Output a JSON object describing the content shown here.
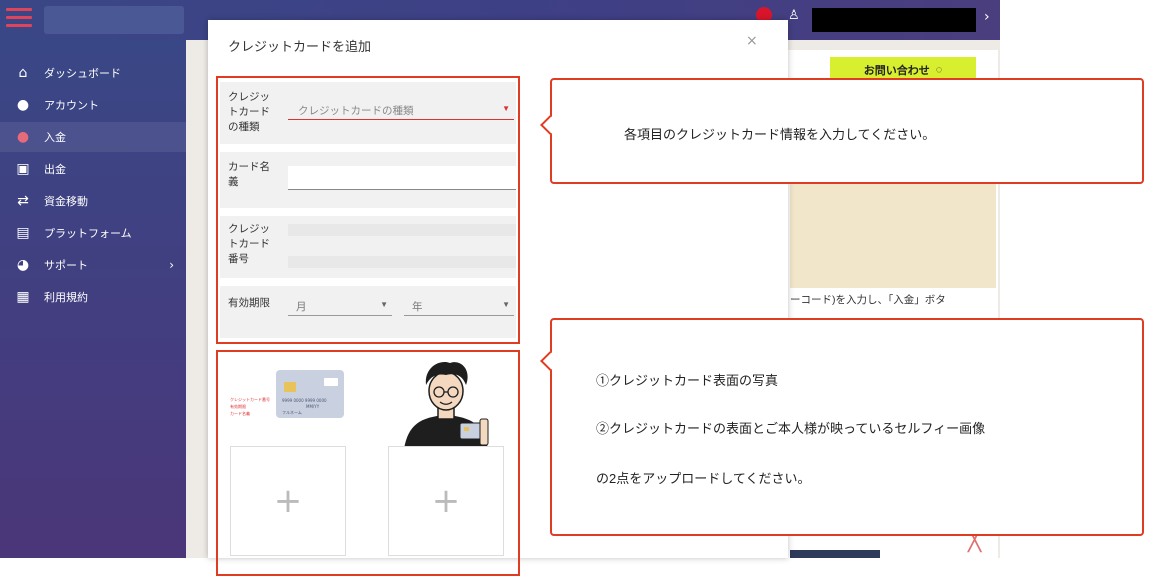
{
  "topbar": {
    "user_icon": "user-icon",
    "user_name": "",
    "arrow": "›"
  },
  "sidebar": {
    "items": [
      {
        "label": "ダッシュボード",
        "icon": "home-icon",
        "glyph": "⌂"
      },
      {
        "label": "アカウント",
        "icon": "account-icon",
        "glyph": "●"
      },
      {
        "label": "入金",
        "icon": "deposit-icon",
        "glyph": "●"
      },
      {
        "label": "出金",
        "icon": "withdraw-icon",
        "glyph": "▣"
      },
      {
        "label": "資金移動",
        "icon": "transfer-icon",
        "glyph": "⇄"
      },
      {
        "label": "プラットフォーム",
        "icon": "platform-icon",
        "glyph": "▤"
      },
      {
        "label": "サポート",
        "icon": "support-icon",
        "glyph": "◕",
        "chevron": "›"
      },
      {
        "label": "利用規約",
        "icon": "terms-icon",
        "glyph": "▦"
      }
    ]
  },
  "background": {
    "contact_button": "お問い合わせ",
    "contact_icon_glyph": "◌",
    "note": "ーコード)を入力し、「入金」ボタ",
    "close_glyph": "╳"
  },
  "modal": {
    "title": "クレジットカードを追加",
    "close_glyph": "×",
    "fields": {
      "card_type_label": "クレジッ\nトカード\nの種類",
      "card_type_placeholder": "クレジットカードの種類",
      "card_name_label": "カード名\n義",
      "card_name_value": "",
      "card_number_label": "クレジッ\nトカード\n番号",
      "expiry_label": "有効期限",
      "month_placeholder": "月",
      "year_placeholder": "年",
      "caret": "▼"
    },
    "card_illustration": {
      "number": "9999 0000 9999 0000",
      "name": "フルネーム",
      "valid": "MM/YY",
      "label_number": "クレジットカード番号",
      "label_valid": "有効期限",
      "label_name": "カード名義"
    },
    "upload": {
      "plus_1": "+",
      "plus_2": "+"
    }
  },
  "callouts": {
    "top": "各項目のクレジットカード情報を入力してください。",
    "bottom_line1": "①クレジットカード表面の写真",
    "bottom_line2": "②クレジットカードの表面とご本人様が映っているセルフィー画像",
    "bottom_line3": "の2点をアップロードしてください。"
  },
  "colors": {
    "accent_red": "#e03c22",
    "sidebar_bg": "#3a4786",
    "contact_yellow": "#d7ef2e"
  }
}
